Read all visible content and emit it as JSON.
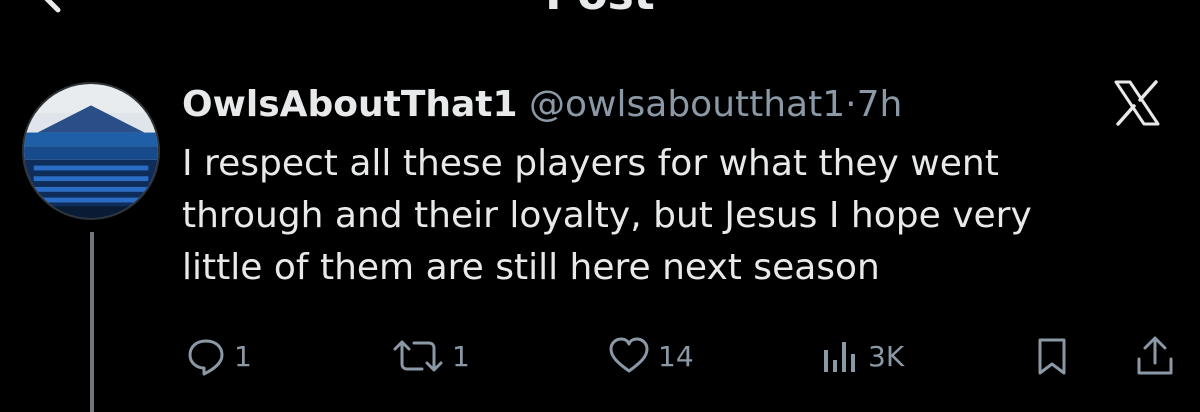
{
  "header": {
    "title": "Post",
    "back_icon": "arrow-left-icon",
    "more_icon": "more-dots-icon"
  },
  "tweet": {
    "avatar": "stadium-avatar",
    "display_name": "OwlsAboutThat1",
    "handle": "@owlsaboutthat1",
    "separator": "·",
    "time": "7h",
    "platform_icon": "x-logo-icon",
    "text": "I respect all these players for what they went\nthrough and their loyalty, but Jesus I hope very\nlittle of them are still here next season"
  },
  "actions": {
    "reply": {
      "icon": "reply-icon",
      "count": "1"
    },
    "repost": {
      "icon": "repost-icon",
      "count": "1"
    },
    "like": {
      "icon": "heart-icon",
      "count": "14"
    },
    "views": {
      "icon": "views-icon",
      "count": "3K"
    },
    "bookmark": {
      "icon": "bookmark-icon"
    },
    "share": {
      "icon": "share-icon"
    }
  },
  "colors": {
    "background": "#000000",
    "text": "#e7e9ea",
    "muted": "#8b98a5",
    "thread_line": "#6e767d"
  }
}
